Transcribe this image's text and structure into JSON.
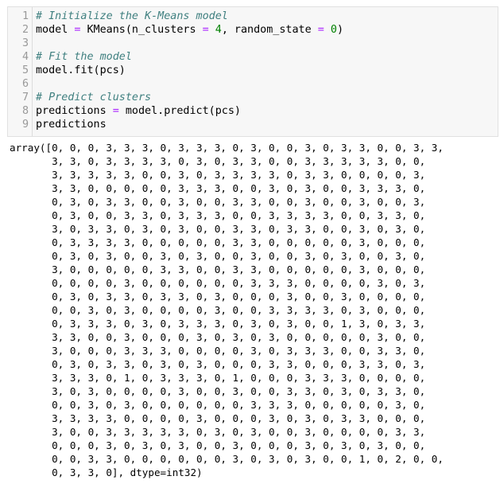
{
  "code_cell": {
    "lines": [
      {
        "no": "1",
        "tokens": [
          {
            "type": "comment",
            "text": "# Initialize the K-Means model"
          }
        ]
      },
      {
        "no": "2",
        "tokens": [
          {
            "type": "plain",
            "text": "model "
          },
          {
            "type": "op",
            "text": "="
          },
          {
            "type": "plain",
            "text": " KMeans(n_clusters "
          },
          {
            "type": "op",
            "text": "="
          },
          {
            "type": "plain",
            "text": " "
          },
          {
            "type": "num",
            "text": "4"
          },
          {
            "type": "plain",
            "text": ", random_state "
          },
          {
            "type": "op",
            "text": "="
          },
          {
            "type": "plain",
            "text": " "
          },
          {
            "type": "num",
            "text": "0"
          },
          {
            "type": "plain",
            "text": ")"
          }
        ]
      },
      {
        "no": "3",
        "tokens": []
      },
      {
        "no": "4",
        "tokens": [
          {
            "type": "comment",
            "text": "# Fit the model"
          }
        ]
      },
      {
        "no": "5",
        "tokens": [
          {
            "type": "plain",
            "text": "model.fit(pcs)"
          }
        ]
      },
      {
        "no": "6",
        "tokens": []
      },
      {
        "no": "7",
        "tokens": [
          {
            "type": "comment",
            "text": "# Predict clusters"
          }
        ]
      },
      {
        "no": "8",
        "tokens": [
          {
            "type": "plain",
            "text": "predictions "
          },
          {
            "type": "op",
            "text": "="
          },
          {
            "type": "plain",
            "text": " model.predict(pcs)"
          }
        ]
      },
      {
        "no": "9",
        "tokens": [
          {
            "type": "plain",
            "text": "predictions"
          }
        ]
      }
    ]
  },
  "output": {
    "lines": [
      "array([0, 0, 0, 3, 3, 3, 0, 3, 3, 3, 0, 3, 0, 0, 3, 0, 3, 3, 0, 0, 3, 3,",
      "       3, 3, 0, 3, 3, 3, 3, 0, 3, 0, 3, 3, 0, 0, 3, 3, 3, 3, 3, 0, 0,",
      "       3, 3, 3, 3, 3, 0, 0, 3, 0, 3, 3, 3, 3, 0, 3, 3, 0, 0, 0, 0, 3,",
      "       3, 3, 0, 0, 0, 0, 0, 3, 3, 3, 0, 0, 3, 0, 3, 0, 0, 3, 3, 3, 0,",
      "       0, 3, 0, 3, 3, 0, 0, 3, 0, 0, 3, 3, 0, 0, 3, 0, 0, 3, 0, 0, 3,",
      "       0, 3, 0, 0, 3, 3, 0, 3, 3, 3, 0, 0, 3, 3, 3, 3, 0, 0, 3, 3, 0,",
      "       3, 0, 3, 3, 0, 3, 0, 3, 0, 0, 3, 3, 0, 3, 3, 0, 0, 3, 0, 3, 0,",
      "       0, 3, 3, 3, 3, 0, 0, 0, 0, 0, 3, 3, 0, 0, 0, 0, 0, 3, 0, 0, 0,",
      "       0, 3, 0, 3, 0, 0, 3, 0, 3, 0, 0, 3, 0, 0, 3, 0, 3, 0, 0, 3, 0,",
      "       3, 0, 0, 0, 0, 0, 3, 3, 0, 0, 3, 3, 0, 0, 0, 0, 0, 3, 0, 0, 0,",
      "       0, 0, 0, 0, 3, 0, 0, 0, 0, 0, 0, 3, 3, 3, 0, 0, 0, 0, 3, 0, 3,",
      "       0, 3, 0, 3, 3, 0, 3, 3, 0, 3, 0, 0, 0, 3, 0, 0, 3, 0, 0, 0, 0,",
      "       0, 0, 3, 0, 3, 0, 0, 0, 0, 3, 0, 0, 3, 3, 3, 3, 0, 3, 0, 0, 0,",
      "       0, 3, 3, 3, 0, 3, 0, 3, 3, 3, 0, 3, 0, 3, 0, 0, 1, 3, 0, 3, 3,",
      "       3, 3, 0, 0, 3, 0, 0, 0, 3, 0, 3, 0, 3, 0, 0, 0, 0, 0, 3, 0, 0,",
      "       3, 0, 0, 0, 3, 3, 3, 0, 0, 0, 0, 3, 0, 3, 3, 3, 0, 0, 3, 3, 0,",
      "       0, 3, 0, 3, 3, 0, 3, 0, 3, 0, 0, 0, 3, 3, 0, 0, 0, 3, 3, 0, 3,",
      "       3, 3, 3, 0, 1, 0, 3, 3, 3, 0, 1, 0, 0, 0, 3, 3, 3, 0, 0, 0, 0,",
      "       3, 0, 3, 0, 0, 0, 0, 3, 0, 0, 3, 0, 0, 3, 3, 0, 3, 0, 3, 3, 0,",
      "       0, 0, 3, 0, 3, 0, 0, 0, 0, 0, 0, 3, 3, 3, 0, 0, 0, 0, 0, 3, 0,",
      "       3, 3, 3, 3, 0, 0, 0, 0, 3, 0, 0, 0, 3, 0, 3, 0, 3, 3, 0, 0, 0,",
      "       3, 0, 0, 3, 3, 3, 3, 3, 0, 3, 0, 3, 0, 0, 3, 0, 0, 0, 0, 3, 3,",
      "       0, 0, 0, 3, 0, 3, 0, 3, 0, 0, 3, 0, 0, 0, 3, 0, 3, 0, 3, 0, 0,",
      "       0, 0, 3, 3, 0, 0, 0, 0, 0, 0, 3, 0, 3, 0, 3, 0, 0, 1, 0, 2, 0, 0,",
      "       0, 3, 3, 0], dtype=int32)"
    ]
  },
  "colors": {
    "comment": "#408080",
    "operator": "#aa22ff",
    "number": "#008000",
    "cell_background": "#f7f7f7",
    "line_number": "#999999"
  }
}
